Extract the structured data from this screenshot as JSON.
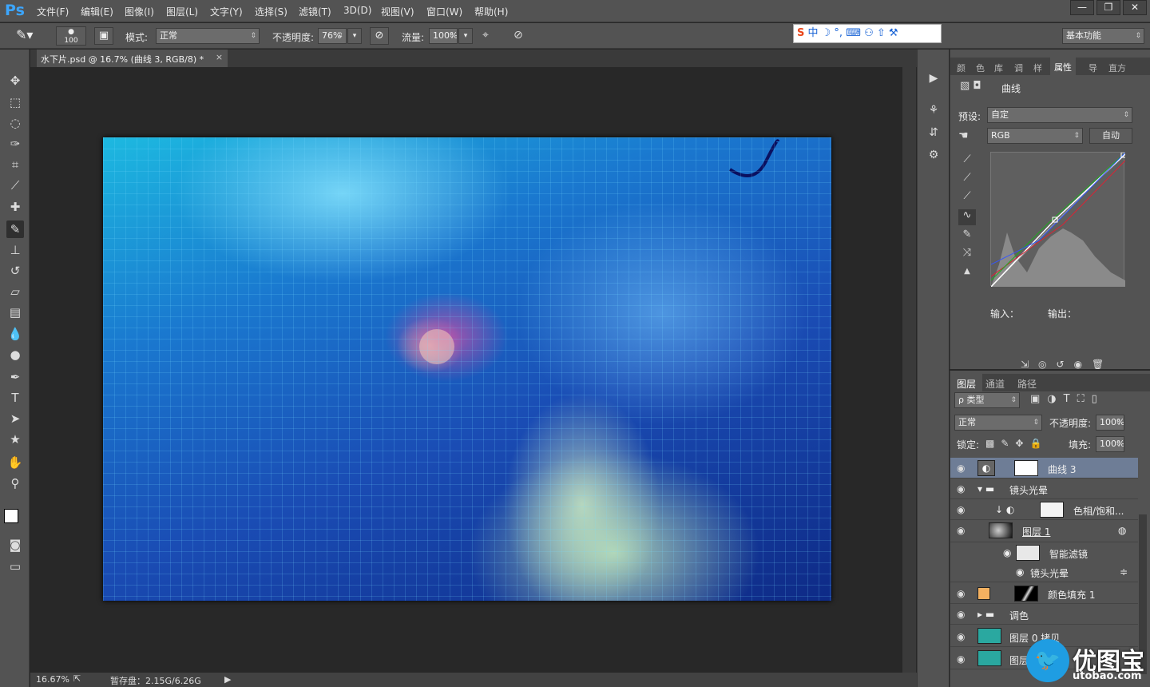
{
  "app": {
    "logo": "Ps"
  },
  "menu": [
    "文件(F)",
    "编辑(E)",
    "图像(I)",
    "图层(L)",
    "文字(Y)",
    "选择(S)",
    "滤镜(T)",
    "3D(D)",
    "视图(V)",
    "窗口(W)",
    "帮助(H)"
  ],
  "window_controls": [
    "—",
    "❐",
    "✕"
  ],
  "options": {
    "brush_size": "100",
    "mode_label": "模式:",
    "mode_value": "正常",
    "opacity_label": "不透明度:",
    "opacity_value": "76%",
    "flow_label": "流量:",
    "flow_value": "100%",
    "workspace": "基本功能"
  },
  "ime": {
    "logo": "S",
    "text": "中 ☽ °, ⌨ ⚇ ⇧ ⚒"
  },
  "document": {
    "tab_title": "水下片.psd @ 16.7% (曲线 3, RGB/8) *",
    "close": "×"
  },
  "status": {
    "zoom": "16.67%",
    "scratch": "暂存盘：2.15G/6.26G"
  },
  "properties": {
    "tabs": [
      "颜",
      "色",
      "库",
      "调",
      "样",
      "属性",
      "导",
      "直方"
    ],
    "title": "曲线",
    "preset_label": "预设:",
    "preset_value": "自定",
    "channel_value": "RGB",
    "auto_button": "自动",
    "input_label": "输入：",
    "output_label": "输出："
  },
  "layers_panel": {
    "tabs": [
      "图层",
      "通道",
      "路径"
    ],
    "filter_value": "ρ 类型",
    "blend_value": "正常",
    "opacity_label": "不透明度:",
    "opacity_value": "100%",
    "lock_label": "锁定:",
    "fill_label": "填充:",
    "fill_value": "100%",
    "layers": [
      {
        "name": "曲线 3"
      },
      {
        "name": "镜头光晕"
      },
      {
        "name": "色相/饱和..."
      },
      {
        "name": "图层 1"
      },
      {
        "name": "智能滤镜"
      },
      {
        "name": "镜头光晕"
      },
      {
        "name": "颜色填充 1"
      },
      {
        "name": "调色"
      },
      {
        "name": "图层 0 拷贝"
      },
      {
        "name": "图层"
      }
    ]
  },
  "watermark": {
    "brand": "优图宝",
    "url": "utobao.com"
  }
}
